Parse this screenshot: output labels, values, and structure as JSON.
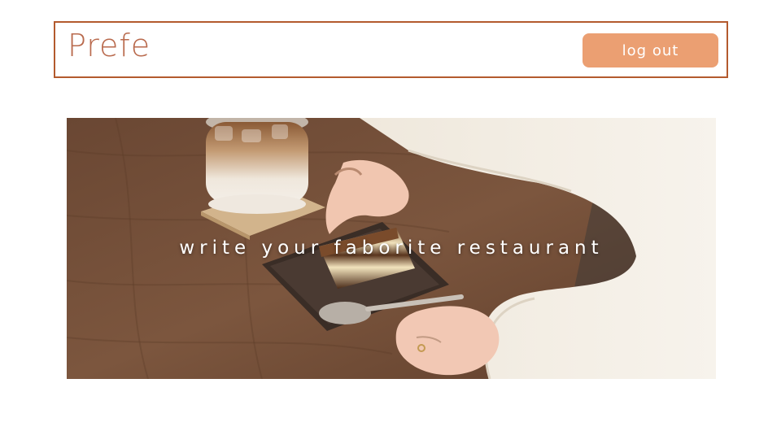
{
  "header": {
    "brand": "Prefe",
    "logout_label": "log out"
  },
  "hero": {
    "caption": "write your faborite restaurant",
    "image_subject": "tiramisu on plate with iced latte on wooden table"
  },
  "colors": {
    "brand_text": "#b96a4d",
    "header_border": "#b35a2e",
    "button_bg": "#eb9f72",
    "button_text": "#ffffff"
  }
}
